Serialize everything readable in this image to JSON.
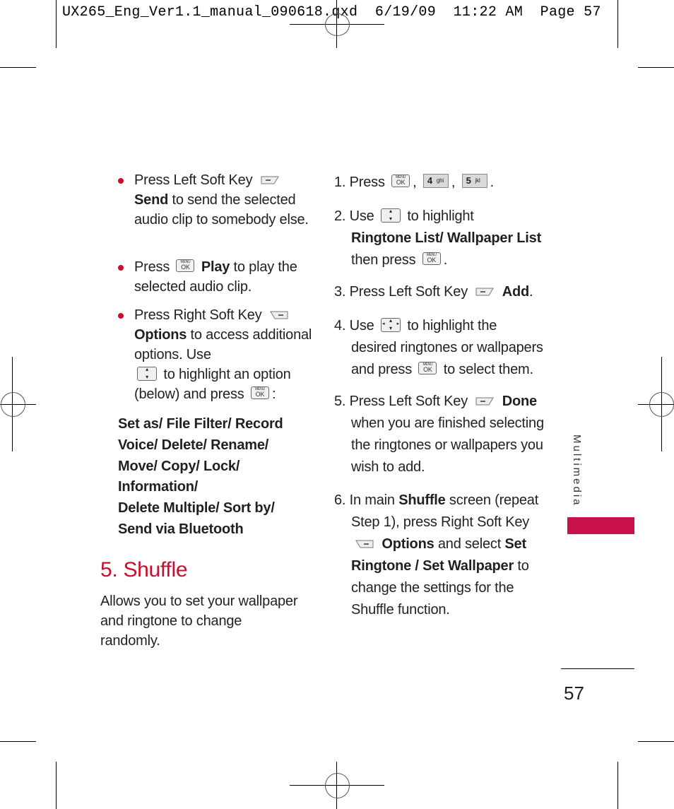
{
  "slug": {
    "filename": "UX265_Eng_Ver1.1_manual_090618.qxd",
    "date": "6/19/09",
    "time": "11:22 AM",
    "page_label": "Page 57"
  },
  "left_column": {
    "bullets": [
      {
        "prefix": "Press Left Soft Key",
        "key_icon": "left-soft-key-icon",
        "bold": "Send",
        "suffix": "to send the selected audio clip to somebody else."
      },
      {
        "prefix": "Press",
        "key_icon": "menu-ok-key-icon",
        "bold": "Play",
        "suffix": "to play the selected audio clip."
      },
      {
        "prefix": "Press Right Soft Key",
        "key_icon": "right-soft-key-icon",
        "bold": "Options",
        "suffix": "to access additional options. Use",
        "suffix2": "to highlight an option",
        "suffix3": "(below) and press",
        "suffix4": ":"
      }
    ],
    "options_list": "Set as/ File Filter/ Record Voice/ Delete/ Rename/ Move/ Copy/ Lock/ Information/ Delete Multiple/ Sort by/ Send via Bluetooth",
    "options_lines": [
      "Set as/ File Filter/ Record",
      "Voice/ Delete/ Rename/",
      "Move/ Copy/ Lock/",
      "Information/",
      "Delete Multiple/ Sort by/",
      "Send via Bluetooth"
    ],
    "section": {
      "title": "5. Shuffle",
      "description_lines": [
        "Allows you to set your wallpaper",
        "and ringtone to change",
        "randomly."
      ]
    }
  },
  "right_column": {
    "steps": [
      {
        "num": "1.",
        "text_a": "Press",
        "sep1": ",",
        "sep2": ",",
        "end": ".",
        "key4": {
          "n": "4",
          "l": "ghi"
        },
        "key5": {
          "n": "5",
          "l": "jkl"
        }
      },
      {
        "num": "2.",
        "text_a": "Use",
        "text_b": "to highlight",
        "bold": "Ringtone List/ Wallpaper List",
        "text_c": "then press",
        "end": "."
      },
      {
        "num": "3.",
        "text_a": "Press Left Soft Key",
        "bold": "Add",
        "end": "."
      },
      {
        "num": "4.",
        "text_a": "Use",
        "text_b": "to highlight the",
        "line2": "desired ringtones or wallpapers",
        "line3a": "and press",
        "line3b": "to select them."
      },
      {
        "num": "5.",
        "text_a": "Press Left Soft Key",
        "bold": "Done",
        "line2": "when you are finished selecting",
        "line3": "the ringtones or wallpapers you",
        "line4": "wish to add."
      },
      {
        "num": "6.",
        "text_a": "In main",
        "bold_a": "Shuffle",
        "text_b": "screen (repeat",
        "line2": "Step 1), press Right Soft Key",
        "bold_b": "Options",
        "text_c": "and select",
        "bold_c": "Set",
        "bold_d": "Ringtone / Set Wallpaper",
        "text_d": "to",
        "line5": "change the settings for the",
        "line6": "Shuffle function."
      }
    ]
  },
  "keys": {
    "menu_label": "MENU",
    "ok_label": "OK",
    "nav_up": "ˆ",
    "nav_down": "ˇ"
  },
  "sidebar": {
    "label": "Multimedia",
    "accent_color": "#c8104a"
  },
  "footer": {
    "page_number": "57"
  },
  "colors": {
    "heading": "#c8102e",
    "bullet": "#c8102e",
    "text": "#231f20"
  }
}
